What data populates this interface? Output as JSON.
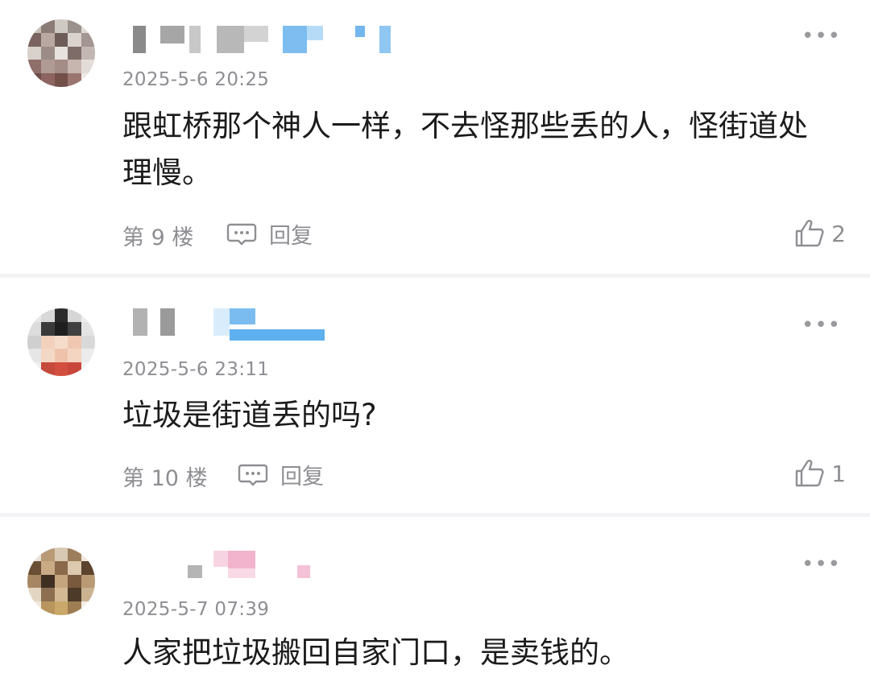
{
  "comments": [
    {
      "date": "2025-5-6 20:25",
      "text": "跟虹桥那个神人一样，不去怪那些丢的人，怪街道处理慢。",
      "floor": "第 9 楼",
      "reply_label": "回复",
      "likes": "2",
      "more": "•••"
    },
    {
      "date": "2025-5-6 23:11",
      "text": "垃圾是街道丢的吗?",
      "floor": "第 10 楼",
      "reply_label": "回复",
      "likes": "1",
      "more": "•••"
    },
    {
      "date": "2025-5-7 07:39",
      "text": "人家把垃圾搬回自家门口，是卖钱的。",
      "more": "•••"
    }
  ],
  "icons": {
    "reply": "comment-bubble-icon",
    "like": "thumbs-up-icon",
    "more": "more-dots-icon"
  },
  "colors": {
    "text": "#1b1b1b",
    "meta": "#8e8e93",
    "divider": "#f3f3f5",
    "blur_blue": "#5fb0ee",
    "blur_pink": "#f2b3cc",
    "blur_gray": "#b5b5b5"
  }
}
